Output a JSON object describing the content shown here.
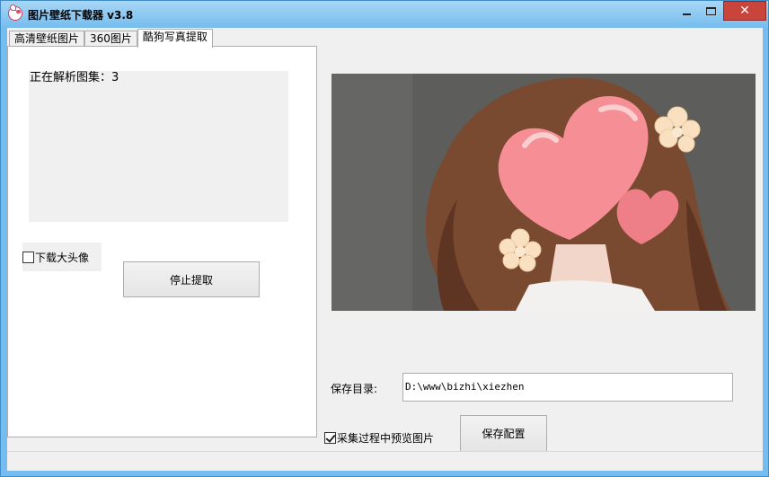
{
  "window": {
    "title": "图片壁纸下载器 v3.8",
    "close_glyph": "✕"
  },
  "tabs": [
    {
      "label": "高清壁纸图片",
      "active": false
    },
    {
      "label": "360图片",
      "active": false
    },
    {
      "label": "酷狗写真提取",
      "active": true
    }
  ],
  "panel": {
    "log_text": "正在解析图集：3",
    "download_avatar_label": "下载大头像",
    "download_avatar_checked": false,
    "stop_button_label": "停止提取"
  },
  "preview": {
    "icon": "preview-image"
  },
  "settings": {
    "save_dir_label": "保存目录:",
    "save_dir_value": "D:\\www\\bizhi\\xiezhen",
    "preview_checkbox_label": "采集过程中预览图片",
    "preview_checkbox_checked": true,
    "save_config_label": "保存配置"
  },
  "colors": {
    "titlebar": "#75bdee",
    "close_button": "#c9443a",
    "preview_bg": "#5b5b59",
    "heart": "#f58f95"
  }
}
